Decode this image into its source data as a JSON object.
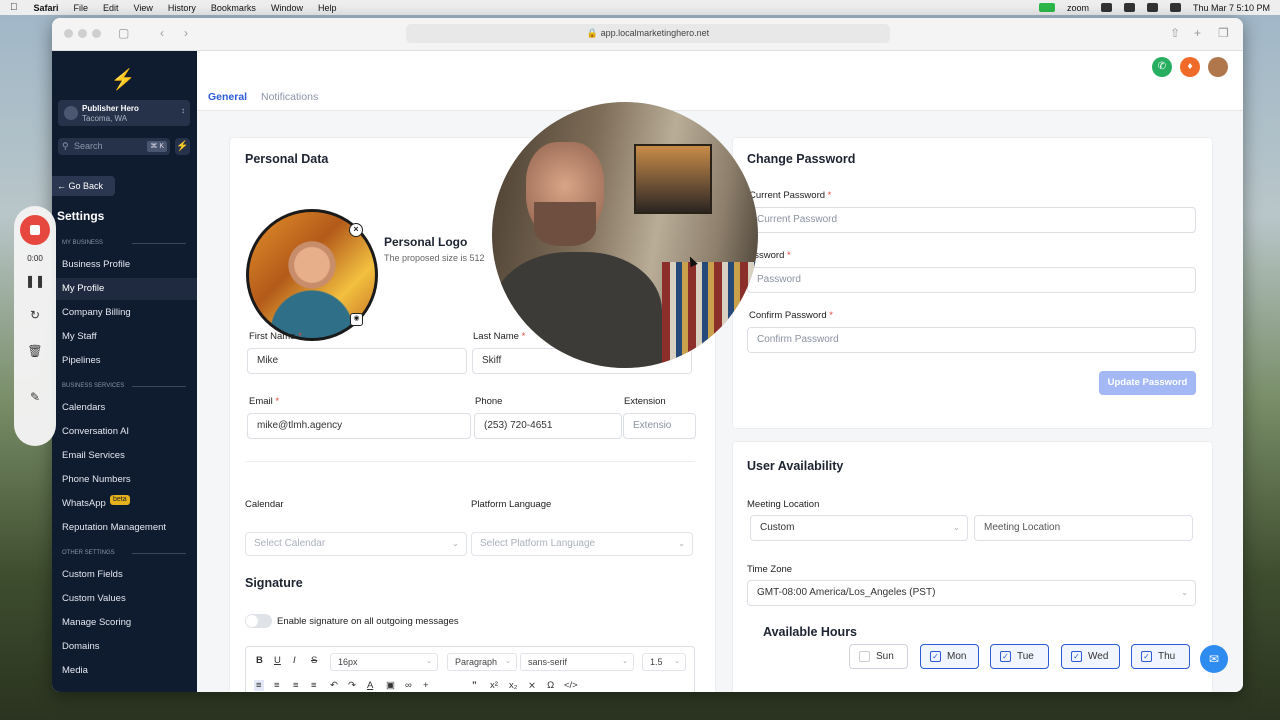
{
  "menubar": {
    "app": "Safari",
    "items": [
      "File",
      "Edit",
      "View",
      "History",
      "Bookmarks",
      "Window",
      "Help"
    ],
    "zoom": "zoom",
    "clock": "Thu Mar 7  5:10 PM"
  },
  "browser": {
    "url": "app.localmarketinghero.net"
  },
  "sidebar": {
    "account_name": "Publisher Hero",
    "account_location": "Tacoma, WA",
    "search_placeholder": "Search",
    "search_shortcut": "⌘ K",
    "go_back": "Go Back",
    "settings_title": "Settings",
    "sections": {
      "my_business": "MY BUSINESS",
      "business_services": "BUSINESS SERVICES",
      "other_settings": "OTHER SETTINGS"
    },
    "items": [
      "Business Profile",
      "My Profile",
      "Company Billing",
      "My Staff",
      "Pipelines",
      "Calendars",
      "Conversation AI",
      "Email Services",
      "Phone Numbers",
      "WhatsApp",
      "Reputation Management",
      "Custom Fields",
      "Custom Values",
      "Manage Scoring",
      "Domains",
      "Media"
    ],
    "active": "My Profile",
    "beta_badge": "beta"
  },
  "tabs": [
    "General",
    "Notifications"
  ],
  "personal": {
    "title": "Personal Data",
    "logo_title": "Personal Logo",
    "logo_hint": "The proposed size is 512",
    "first_name_label": "First Name",
    "first_name": "Mike",
    "last_name_label": "Last Name",
    "last_name": "Skiff",
    "email_label": "Email",
    "email": "mike@tlmh.agency",
    "phone_label": "Phone",
    "phone": "(253) 720-4651",
    "extension_label": "Extension",
    "extension_placeholder": "Extensio",
    "calendar_label": "Calendar",
    "calendar_placeholder": "Select Calendar",
    "language_label": "Platform Language",
    "language_placeholder": "Select Platform Language",
    "signature_title": "Signature",
    "signature_toggle": "Enable signature on all outgoing messages",
    "editor": {
      "font_size": "16px",
      "block": "Paragraph",
      "font": "sans-serif",
      "line_height": "1.5"
    }
  },
  "password": {
    "title": "Change Password",
    "current_label": "Current Password",
    "current_placeholder": "Current Password",
    "new_label": "assword",
    "new_placeholder": "Password",
    "confirm_label": "Confirm Password",
    "confirm_placeholder": "Confirm Password",
    "button": "Update Password"
  },
  "availability": {
    "title": "User Availability",
    "meeting_label": "Meeting Location",
    "meeting_type": "Custom",
    "meeting_placeholder": "Meeting Location",
    "tz_label": "Time Zone",
    "timezone": "GMT-08:00 America/Los_Angeles (PST)",
    "hours_title": "Available Hours",
    "days": [
      {
        "label": "Sun",
        "checked": false
      },
      {
        "label": "Mon",
        "checked": true
      },
      {
        "label": "Tue",
        "checked": true
      },
      {
        "label": "Wed",
        "checked": true
      },
      {
        "label": "Thu",
        "checked": true
      }
    ]
  },
  "recorder": {
    "time": "0:00"
  },
  "colors": {
    "accent": "#2d5bd7",
    "sidebar": "#0f1b2f",
    "record": "#e8453c"
  }
}
